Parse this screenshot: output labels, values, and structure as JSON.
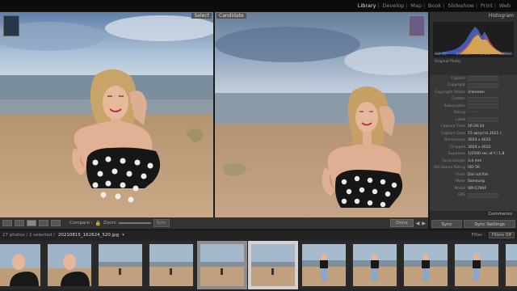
{
  "modules": [
    "Library",
    "Develop",
    "Map",
    "Book",
    "Slideshow",
    "Print",
    "Web"
  ],
  "active_module": "Library",
  "compare": {
    "select_tag": "Select",
    "candidate_tag": "Candidate"
  },
  "toolbar": {
    "compare_label": "Compare :",
    "zoom_label": "Zoom",
    "sync_label": "Sync",
    "done_label": "Done"
  },
  "panel": {
    "histogram_title": "Histogram",
    "iso": "ISO 50",
    "focal": "3.4 mm",
    "aperture": "f / 1.8",
    "shutter": "1/2500",
    "original_photo": "Original Photo",
    "metadata": [
      {
        "key": "Caption",
        "value": ""
      },
      {
        "key": "Copyright",
        "value": ""
      },
      {
        "key": "Copyright Status",
        "value": "Unknown"
      },
      {
        "key": "Creator",
        "value": ""
      },
      {
        "key": "Sublocation",
        "value": ""
      },
      {
        "key": "Rating",
        "value": "· · · · ·"
      },
      {
        "key": "Label",
        "value": ""
      },
      {
        "key": "Capture Time",
        "value": "16:26:24"
      },
      {
        "key": "Capture Date",
        "value": "15 августа 2021 г."
      },
      {
        "key": "Dimensions",
        "value": "3024 x 4032"
      },
      {
        "key": "Cropped",
        "value": "3024 x 4032"
      },
      {
        "key": "Exposure",
        "value": "1/2500 sec at f / 1.8"
      },
      {
        "key": "Focal Length",
        "value": "3.4 mm"
      },
      {
        "key": "ISO Speed Rating",
        "value": "ISO 50"
      },
      {
        "key": "Flash",
        "value": "Did not fire"
      },
      {
        "key": "Make",
        "value": "Samsung"
      },
      {
        "key": "Model",
        "value": "SM-G780F"
      },
      {
        "key": "GPS",
        "value": ""
      }
    ],
    "comments_label": "Comments",
    "sync_button": "Sync",
    "sync_settings_button": "Sync Settings"
  },
  "filmstrip": {
    "count_text": "27 photos / 2 selected /",
    "filename": "20210815_162624_520.jpg",
    "filter_label": "Filter :",
    "filter_value": "Filters Off"
  }
}
